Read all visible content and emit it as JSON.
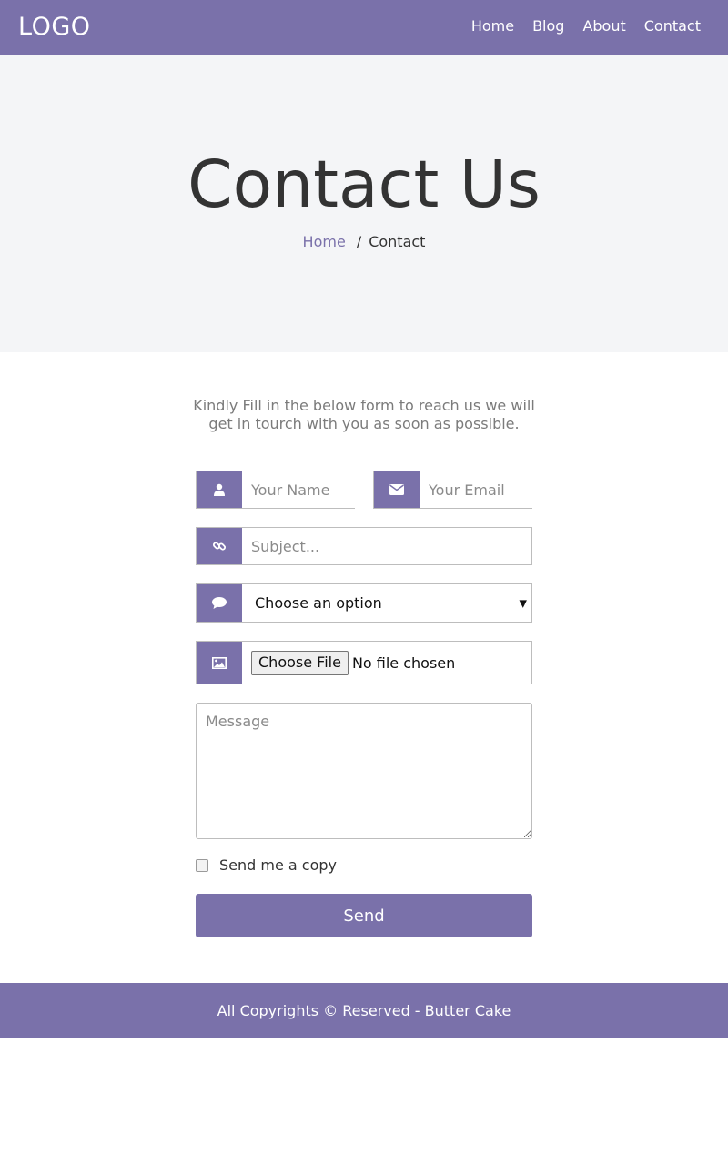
{
  "header": {
    "logo": "LOGO",
    "nav": [
      {
        "label": "Home"
      },
      {
        "label": "Blog"
      },
      {
        "label": "About"
      },
      {
        "label": "Contact"
      }
    ]
  },
  "hero": {
    "title": "Contact Us",
    "breadcrumb": {
      "home": "Home",
      "separator": "/",
      "current": "Contact"
    }
  },
  "form": {
    "intro": "Kindly Fill in the below form to reach us we will get in tourch with you as soon as possible.",
    "name_placeholder": "Your Name",
    "email_placeholder": "Your Email",
    "subject_placeholder": "Subject...",
    "select_value": "Choose an option",
    "file_button": "Choose File",
    "file_status": "No file chosen",
    "message_placeholder": "Message",
    "checkbox_label": "Send me a copy",
    "submit_label": "Send",
    "icons": {
      "name": "user-icon",
      "email": "envelope-icon",
      "subject": "link-icon",
      "select": "comment-icon",
      "file": "image-icon"
    }
  },
  "footer": {
    "text": "All Copyrights © Reserved - Butter Cake"
  },
  "colors": {
    "accent": "#7a71aa",
    "hero_bg": "#f4f5f7",
    "text": "#333333",
    "muted": "#7b7b7b"
  }
}
